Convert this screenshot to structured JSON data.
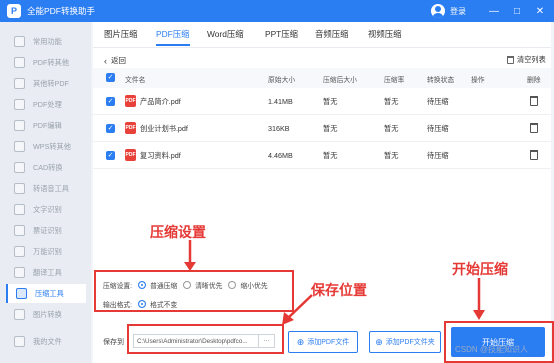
{
  "app": {
    "title": "全能PDF转换助手",
    "login_label": "登录",
    "logo_letter": "P"
  },
  "window_controls": [
    "—",
    "□",
    "✕"
  ],
  "sidebar": {
    "items": [
      {
        "label": "常用功能",
        "active": false
      },
      {
        "label": "PDF转其他",
        "active": false
      },
      {
        "label": "其他转PDF",
        "active": false
      },
      {
        "label": "PDF处理",
        "active": false
      },
      {
        "label": "PDF编辑",
        "active": false
      },
      {
        "label": "WPS转其他",
        "active": false
      },
      {
        "label": "CAD转换",
        "active": false
      },
      {
        "label": "转语音工具",
        "active": false
      },
      {
        "label": "文字识别",
        "active": false
      },
      {
        "label": "票证识别",
        "active": false
      },
      {
        "label": "万能识别",
        "active": false
      },
      {
        "label": "翻译工具",
        "active": false
      },
      {
        "label": "压缩工具",
        "active": true
      },
      {
        "label": "图片转换",
        "active": false
      }
    ],
    "bottom": "我的文件"
  },
  "tabs": [
    "图片压缩",
    "PDF压缩",
    "Word压缩",
    "PPT压缩",
    "音频压缩",
    "视频压缩"
  ],
  "active_tab": 1,
  "back_label": "返回",
  "clear_label": "清空列表",
  "table": {
    "headers": [
      "文件名",
      "原始大小",
      "压缩后大小",
      "压缩率",
      "转换状态",
      "操作",
      "删除"
    ],
    "rows": [
      {
        "name": "产品简介.pdf",
        "size": "1.41MB",
        "after": "暂无",
        "ratio": "暂无",
        "status": "待压缩"
      },
      {
        "name": "创业计划书.pdf",
        "size": "316KB",
        "after": "暂无",
        "ratio": "暂无",
        "status": "待压缩"
      },
      {
        "name": "复习资料.pdf",
        "size": "4.46MB",
        "after": "暂无",
        "ratio": "暂无",
        "status": "待压缩"
      }
    ]
  },
  "settings": {
    "compress_label": "压缩设置:",
    "options": [
      {
        "label": "普通压缩",
        "selected": true
      },
      {
        "label": "清晰优先",
        "selected": false
      },
      {
        "label": "缩小优先",
        "selected": false
      }
    ],
    "format_label": "输出格式:",
    "format_option": "格式不变"
  },
  "output": {
    "label": "保存到",
    "path": "C:\\Users\\Administrator\\Desktop\\pdfco...",
    "browse": "···",
    "add_file": "添加PDF文件",
    "add_folder": "添加PDF文件夹",
    "start": "开始压缩"
  },
  "annotations": {
    "settings": "压缩设置",
    "save": "保存位置",
    "start": "开始压缩"
  },
  "watermark": "CSDN @技能知识人",
  "colors": {
    "accent": "#2b7df2",
    "annotation": "#e53935",
    "pdf_icon": "#e8413a"
  }
}
